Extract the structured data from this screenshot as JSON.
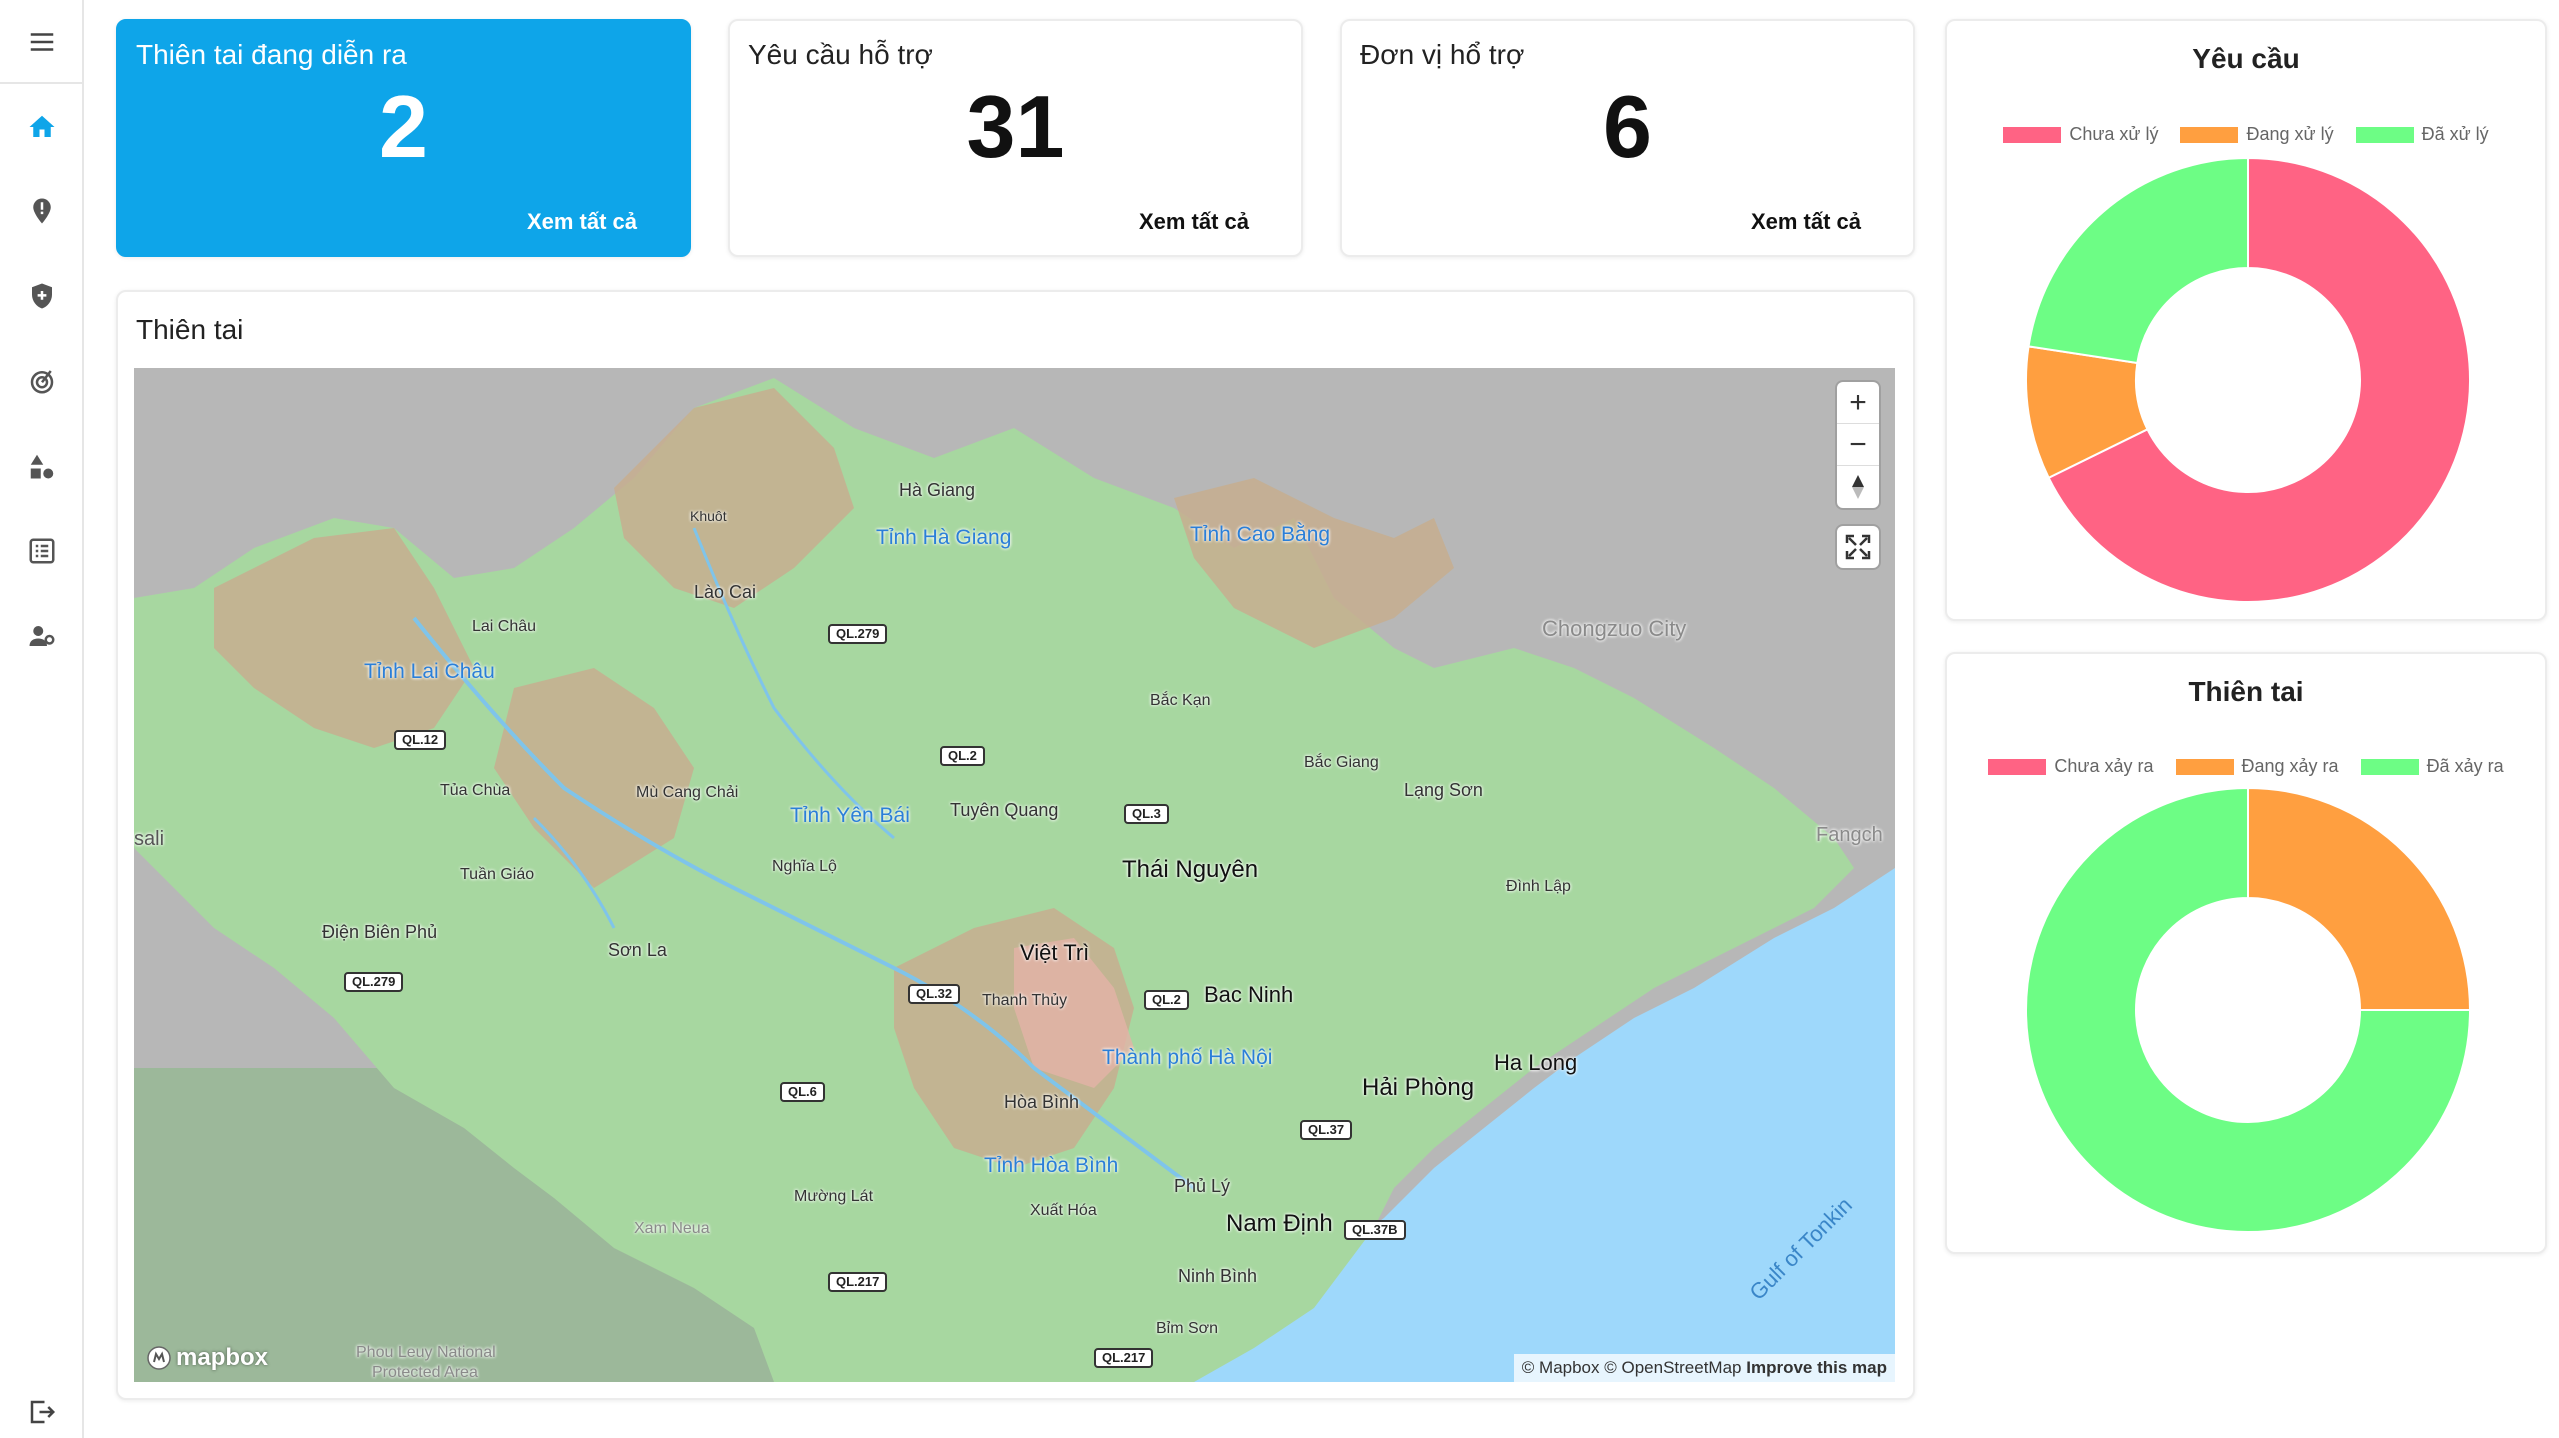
{
  "sidebar": {
    "items": [
      {
        "icon": "menu-icon"
      },
      {
        "icon": "home-icon",
        "active": true
      },
      {
        "icon": "alert-pin-icon"
      },
      {
        "icon": "shield-plus-icon"
      },
      {
        "icon": "target-icon"
      },
      {
        "icon": "shapes-icon"
      },
      {
        "icon": "list-icon"
      },
      {
        "icon": "user-settings-icon"
      },
      {
        "icon": "logout-icon"
      }
    ],
    "accent": "#0ea5e9"
  },
  "stats": [
    {
      "title": "Thiên tai đang diễn ra",
      "value": "2",
      "link": "Xem tất cả"
    },
    {
      "title": "Yêu cầu hỗ trợ",
      "value": "31",
      "link": "Xem tất cả"
    },
    {
      "title": "Đơn vị hổ trợ",
      "value": "6",
      "link": "Xem tất cả"
    }
  ],
  "map_section": {
    "title": "Thiên tai",
    "labels": {
      "ha_giang": "Hà Giang",
      "tinh_ha_giang": "Tỉnh Hà Giang",
      "tinh_cao_bang": "Tỉnh Cao Bằng",
      "lao_cai": "Lào Cai",
      "khuot": "Khuôt",
      "lai_chau": "Lai Châu",
      "tinh_lai_chau": "Tỉnh Lai Châu",
      "bac_kan": "Bắc Kạn",
      "chongzuo": "Chongzuo City",
      "tua_chua": "Tủa Chùa",
      "mu_cang_chai": "Mù Cang Chải",
      "tinh_yen_bai": "Tỉnh Yên Bái",
      "tuyen_quang": "Tuyên Quang",
      "bac_giang": "Bắc Giang",
      "lang_son": "Lạng Sơn",
      "tuan_giao": "Tuần Giáo",
      "nghia_lo": "Nghĩa Lộ",
      "thai_nguyen": "Thái Nguyên",
      "dinh_lap": "Đình Lập",
      "dien_bien_phu": "Điện Biên Phủ",
      "son_la": "Sơn La",
      "viet_tri": "Việt Trì",
      "thanh_thuy": "Thanh Thủy",
      "bac_ninh": "Bac Ninh",
      "ha_noi": "Thành phố Hà Nội",
      "ha_long": "Ha Long",
      "hai_phong": "Hải Phòng",
      "hoa_binh": "Hòa Bình",
      "tinh_hoa_binh": "Tỉnh Hòa Bình",
      "phu_ly": "Phủ Lý",
      "muong_lat": "Mường Lát",
      "xuat_hoa": "Xuất Hóa",
      "nam_dinh": "Nam Định",
      "xam_neua": "Xam Neua",
      "ninh_binh": "Ninh Bình",
      "bim_son": "Bỉm Sơn",
      "phou_leuy": "Phou Leuy National",
      "protected": "Protected Area",
      "sali": "sali",
      "gulf": "Gulf of Tonkin",
      "fangch": "Fangch"
    },
    "roads": {
      "ql279a": "QL.279",
      "ql12": "QL.12",
      "ql2": "QL.2",
      "ql3": "QL.3",
      "ql279b": "QL.279",
      "ql32": "QL.32",
      "ql2b": "QL.2",
      "ql6": "QL.6",
      "ql37": "QL.37",
      "ql37b": "QL.37B",
      "ql217a": "QL.217",
      "ql217b": "QL.217"
    },
    "attribution": "© Mapbox © OpenStreetMap",
    "improve": "Improve this map",
    "logo": "mapbox",
    "controls": {
      "zoom_in": "+",
      "zoom_out": "−"
    }
  },
  "charts": {
    "colors": {
      "red": "#ff6384",
      "orange": "#ff9f40",
      "green": "#6dfd85"
    },
    "chart_data": [
      {
        "type": "pie",
        "title": "Yêu cầu",
        "categories": [
          "Chưa xử lý",
          "Đang xử lý",
          "Đã xử lý"
        ],
        "values": [
          21,
          3,
          7
        ]
      },
      {
        "type": "pie",
        "title": "Thiên tai",
        "categories": [
          "Chưa xảy ra",
          "Đang xảy ra",
          "Đã xảy ra"
        ],
        "values": [
          0,
          1,
          3
        ]
      }
    ]
  }
}
